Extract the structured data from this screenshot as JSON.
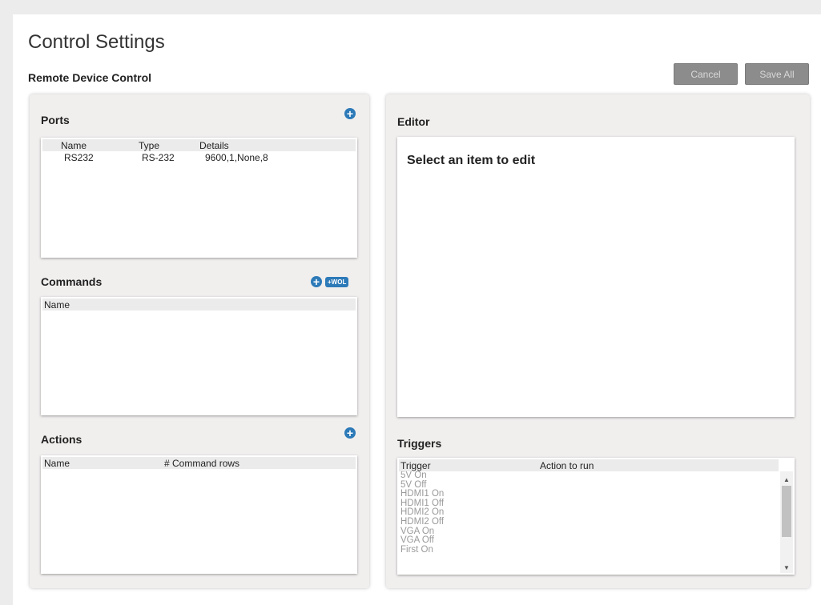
{
  "page": {
    "title": "Control Settings",
    "subtitle": "Remote Device Control",
    "cancel_label": "Cancel",
    "save_label": "Save All"
  },
  "ports": {
    "title": "Ports",
    "columns": [
      "Name",
      "Type",
      "Details"
    ],
    "rows": [
      {
        "name": "RS232",
        "type": "RS-232",
        "details": "9600,1,None,8"
      }
    ]
  },
  "commands": {
    "title": "Commands",
    "wol_label": "WOL",
    "columns": [
      "Name"
    ]
  },
  "actions": {
    "title": "Actions",
    "columns": [
      "Name",
      "# Command rows"
    ]
  },
  "editor": {
    "title": "Editor",
    "placeholder": "Select an item to edit"
  },
  "triggers": {
    "title": "Triggers",
    "columns": [
      "Trigger",
      "Action to run"
    ],
    "items": [
      "5V On",
      "5V Off",
      "HDMI1 On",
      "HDMI1 Off",
      "HDMI2 On",
      "HDMI2 Off",
      "VGA On",
      "VGA Off",
      "First On"
    ]
  },
  "colors": {
    "accent": "#2d7ab8",
    "panel_bg": "#f1efee",
    "button_bg": "#8c8c8c"
  }
}
